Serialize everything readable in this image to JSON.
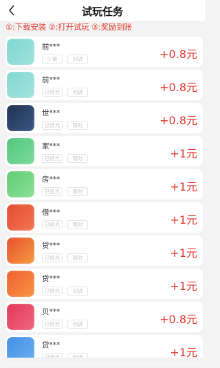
{
  "header": {
    "title": "试玩任务"
  },
  "steps": "①:下载安装 ②:打开试玩 ③:奖励到账",
  "tasks": [
    {
      "name": "前***",
      "tags": [
        "少量",
        "回调"
      ],
      "reward": "+0.8元",
      "icon_colors": [
        "#7fd6d0",
        "#9fe3dc"
      ],
      "icon": "app-icon"
    },
    {
      "name": "前***",
      "tags": [
        "已抢光",
        "回调"
      ],
      "reward": "+0.8元",
      "icon_colors": [
        "#7fd6d0",
        "#a6e5df"
      ],
      "icon": "app-icon"
    },
    {
      "name": "世***",
      "tags": [
        "已抢光",
        "限时"
      ],
      "reward": "+0.8元",
      "icon_colors": [
        "#1f2f4a",
        "#3a5a8a"
      ],
      "icon": "app-icon"
    },
    {
      "name": "家***",
      "tags": [
        "已抢光",
        "限时"
      ],
      "reward": "+1元",
      "icon_colors": [
        "#4fc67a",
        "#7fdc9d"
      ],
      "icon": "app-icon"
    },
    {
      "name": "房***",
      "tags": [
        "已抢光",
        "限时"
      ],
      "reward": "+1元",
      "icon_colors": [
        "#5ccc6e",
        "#8ee09a"
      ],
      "icon": "app-icon"
    },
    {
      "name": "借***",
      "tags": [
        "已抢光",
        "限时"
      ],
      "reward": "+1元",
      "icon_colors": [
        "#e44a2e",
        "#f27855"
      ],
      "icon": "app-icon"
    },
    {
      "name": "贷***",
      "tags": [
        "已抢光",
        "限时"
      ],
      "reward": "+1元",
      "icon_colors": [
        "#e6492b",
        "#f7a045"
      ],
      "icon": "app-icon"
    },
    {
      "name": "贷***",
      "tags": [
        "已抢光",
        "回调"
      ],
      "reward": "+1元",
      "icon_colors": [
        "#ef5a2c",
        "#f89a48"
      ],
      "icon": "app-icon"
    },
    {
      "name": "贝***",
      "tags": [
        "已抢光",
        "回调"
      ],
      "reward": "+0.8元",
      "icon_colors": [
        "#e23454",
        "#f06a82"
      ],
      "icon": "app-icon"
    },
    {
      "name": "贷***",
      "tags": [
        "已抢光",
        "回调"
      ],
      "reward": "+1元",
      "icon_colors": [
        "#3e8fe6",
        "#6fb0f0"
      ],
      "icon": "app-icon"
    }
  ]
}
